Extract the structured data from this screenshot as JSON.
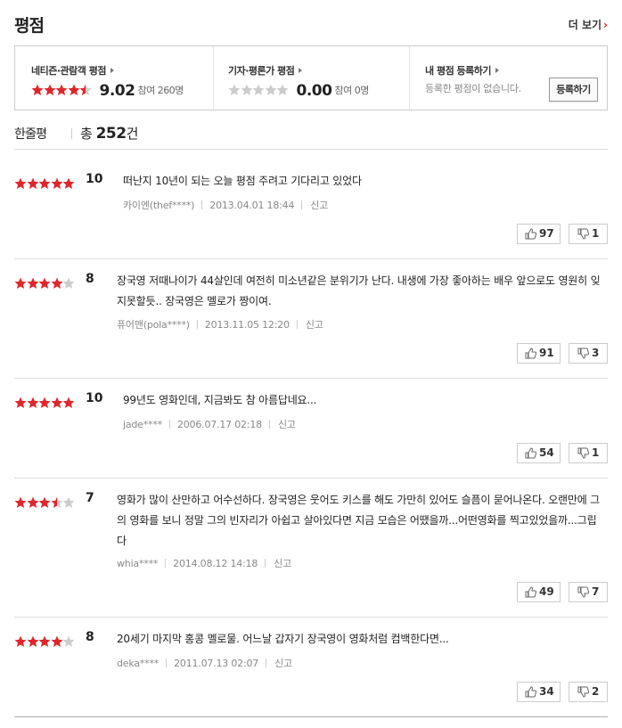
{
  "colors": {
    "star_on": "#e0262c",
    "star_off": "#cccccc",
    "accent": "#e02020"
  },
  "header": {
    "title": "평점",
    "more_label": "더 보기",
    "more_icon": "chevron-right-icon"
  },
  "summary": {
    "netizen": {
      "title": "네티즌·관람객 평점",
      "rating": 9.02,
      "score_text": "9.02",
      "participants_text": "참여 260명"
    },
    "critic": {
      "title": "기자·평론가 평점",
      "rating": 0,
      "score_text": "0.00",
      "participants_text": "참여 0명"
    },
    "mine": {
      "title": "내 평점 등록하기",
      "empty_message": "등록한 평점이 없습니다.",
      "register_label": "등록하기"
    }
  },
  "one_line": {
    "label": "한줄평",
    "total_prefix": "총",
    "total_count": "252",
    "total_suffix": "건"
  },
  "reviews": [
    {
      "stars": 10,
      "score": "10",
      "text": "떠난지 10년이 되는 오늘 평점 주려고 기다리고 있었다",
      "user": "카이엔(thef****)",
      "date": "2013.04.01 18:44",
      "report": "신고",
      "likes": "97",
      "dislikes": "1"
    },
    {
      "stars": 8,
      "score": "8",
      "text": "장국영 저때나이가 44살인데 여전히 미소년같은 분위기가 난다. 내생에 가장 좋아하는 배우 앞으로도 영원히 잊지못할듯.. 장국영은 멜로가 짱이여.",
      "user": "퓨어맨(pola****)",
      "date": "2013.11.05 12:20",
      "report": "신고",
      "likes": "91",
      "dislikes": "3"
    },
    {
      "stars": 10,
      "score": "10",
      "text": "99년도 영화인데, 지금봐도 참 아름답네요...",
      "user": "jade****",
      "date": "2006.07.17 02:18",
      "report": "신고",
      "likes": "54",
      "dislikes": "1"
    },
    {
      "stars": 7,
      "score": "7",
      "text": "영화가 많이 산만하고 어수선하다. 장국영은 웃어도 키스를 해도 가만히 있어도 슬픔이 묻어나온다. 오랜만에 그의 영화를 보니 정말 그의 빈자리가 아쉽고 살아있다면 지금 모습은 어땠을까...어떤영화를 찍고있었을까...그립다",
      "user": "whia****",
      "date": "2014.08.12 14:18",
      "report": "신고",
      "likes": "49",
      "dislikes": "7"
    },
    {
      "stars": 8,
      "score": "8",
      "text": "20세기 마지막 홍콩 멜로물. 어느날 갑자기 장국영이 영화처럼 컴백한다면...",
      "user": "deka****",
      "date": "2011.07.13 02:07",
      "report": "신고",
      "likes": "34",
      "dislikes": "2"
    }
  ]
}
